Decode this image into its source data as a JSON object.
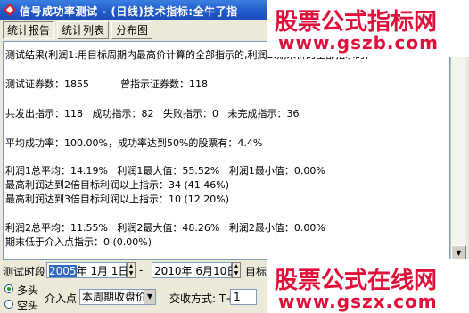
{
  "window": {
    "title": "信号成功率测试 - (日线)技术指标:全牛了指"
  },
  "tabs": [
    {
      "label": "统计报告"
    },
    {
      "label": "统计列表"
    },
    {
      "label": "分布图"
    }
  ],
  "report": {
    "lines": [
      "测试结果(利润1:用目标周期内最高价计算的全部指示的,利润2:期末价的全部指示的)",
      "测试证券数：1855          曾指示证券数：118",
      "共发出指示：118   成功指示：82   失败指示：0   未完成指示：36",
      "平均成功率：100.00%，成功率达到50%的股票有：4.4%",
      "利润1总平均：14.19%   利润1最大值：55.52%   利润1最小值：0.00%",
      "最高利润达到2倍目标利润以上指示：34 (41.46%)",
      "最高利润达到3倍目标利润以上指示：10 (12.20%)",
      "利润2总平均：11.55%   利润2最大值：48.26%   利润2最小值：0.00%",
      "期末低于介入点指示：0 (0.00%)"
    ]
  },
  "controls": {
    "period_label": "测试时段",
    "start_date": {
      "year": "2005",
      "rest": "年 1月 1日"
    },
    "end_date": "2010年 6月10日",
    "target_label": "目标",
    "radio_long": "多头",
    "radio_short": "空头",
    "entry_label": "介入点",
    "entry_value": "本周期收盘价",
    "trade_label": "交收方式: T+",
    "trade_value": "1"
  },
  "watermarks": {
    "top_text": "股票公式指标网",
    "top_url": "www.gszb.com",
    "bottom_text": "股票公式在线网",
    "bottom_url": "www.gszx.com"
  },
  "colors": {
    "title_bar": "#1f58c8",
    "watermark": "#e0103a",
    "selection": "#316ac5"
  }
}
